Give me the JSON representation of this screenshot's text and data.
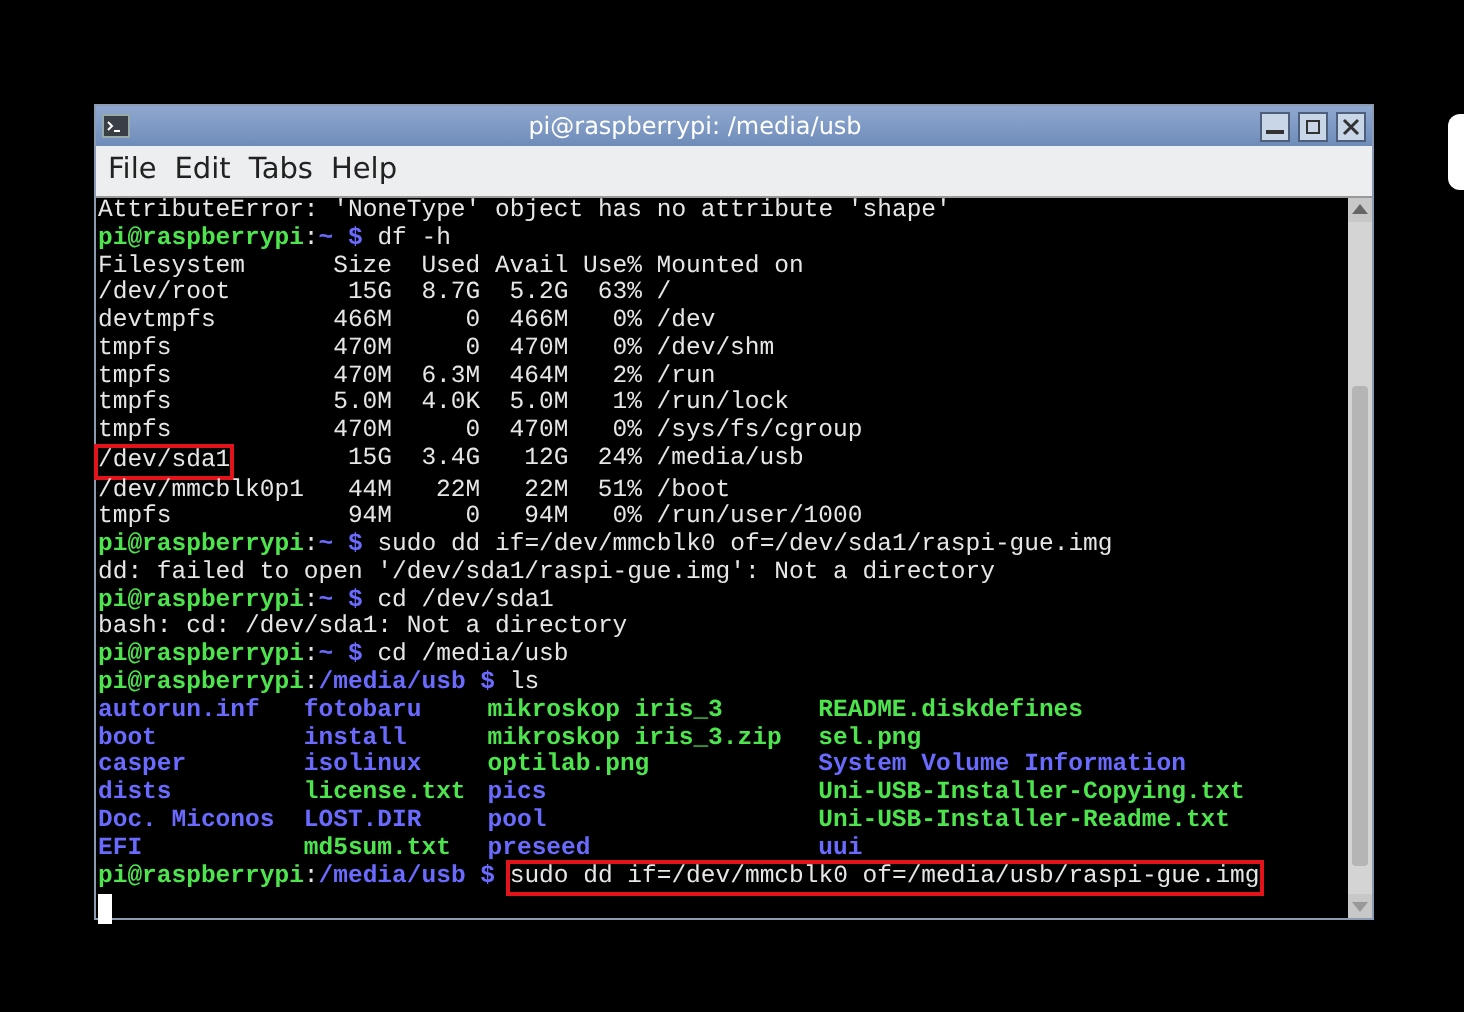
{
  "window": {
    "title": "pi@raspberrypi: /media/usb"
  },
  "menu": [
    {
      "label": "File"
    },
    {
      "label": "Edit"
    },
    {
      "label": "Tabs"
    },
    {
      "label": "Help"
    }
  ],
  "terminal": {
    "blocks": [
      {
        "kind": "line",
        "segments": [
          {
            "text": "AttributeError: 'NoneType' object has no attribute 'shape'",
            "kind": "plain"
          }
        ]
      },
      {
        "kind": "line",
        "segments": [
          {
            "text": "pi@raspberrypi",
            "kind": "user"
          },
          {
            "text": ":",
            "kind": "plain"
          },
          {
            "text": "~ $",
            "kind": "path"
          },
          {
            "text": "df -h",
            "kind": "plain"
          }
        ]
      },
      {
        "kind": "table",
        "columns": [
          "Filesystem",
          "Size",
          "Used",
          "Avail",
          "Use%",
          "Mounted on"
        ],
        "rows": [
          {
            "cells": [
              "/dev/root",
              "15G",
              "8.7G",
              "5.2G",
              "63%",
              "/"
            ],
            "highlighted": false
          },
          {
            "cells": [
              "devtmpfs",
              "466M",
              "0",
              "466M",
              "0%",
              "/dev"
            ],
            "highlighted": false
          },
          {
            "cells": [
              "tmpfs",
              "470M",
              "0",
              "470M",
              "0%",
              "/dev/shm"
            ],
            "highlighted": false
          },
          {
            "cells": [
              "tmpfs",
              "470M",
              "6.3M",
              "464M",
              "2%",
              "/run"
            ],
            "highlighted": false
          },
          {
            "cells": [
              "tmpfs",
              "5.0M",
              "4.0K",
              "5.0M",
              "1%",
              "/run/lock"
            ],
            "highlighted": false
          },
          {
            "cells": [
              "tmpfs",
              "470M",
              "0",
              "470M",
              "0%",
              "/sys/fs/cgroup"
            ],
            "highlighted": false
          },
          {
            "cells": [
              "/dev/sda1",
              "15G",
              "3.4G",
              "12G",
              "24%",
              "/media/usb"
            ],
            "highlighted": true
          },
          {
            "cells": [
              "/dev/mmcblk0p1",
              "44M",
              "22M",
              "22M",
              "51%",
              "/boot"
            ],
            "highlighted": false
          },
          {
            "cells": [
              "tmpfs",
              "94M",
              "0",
              "94M",
              "0%",
              "/run/user/1000"
            ],
            "highlighted": false
          }
        ]
      },
      {
        "kind": "line",
        "segments": [
          {
            "text": "pi@raspberrypi",
            "kind": "user"
          },
          {
            "text": ":",
            "kind": "plain"
          },
          {
            "text": "~ $",
            "kind": "path"
          },
          {
            "text": "sudo dd if=/dev/mmcblk0 of=/dev/sda1/raspi-gue.img",
            "kind": "plain"
          }
        ]
      },
      {
        "kind": "line",
        "segments": [
          {
            "text": "dd: failed to open '/dev/sda1/raspi-gue.img': Not a directory",
            "kind": "plain"
          }
        ]
      },
      {
        "kind": "line",
        "segments": [
          {
            "text": "pi@raspberrypi",
            "kind": "user"
          },
          {
            "text": ":",
            "kind": "plain"
          },
          {
            "text": "~ $",
            "kind": "path"
          },
          {
            "text": "cd /dev/sda1",
            "kind": "plain"
          }
        ]
      },
      {
        "kind": "line",
        "segments": [
          {
            "text": "bash: cd: /dev/sda1: Not a directory",
            "kind": "plain"
          }
        ]
      },
      {
        "kind": "line",
        "segments": [
          {
            "text": "pi@raspberrypi",
            "kind": "user"
          },
          {
            "text": ":",
            "kind": "plain"
          },
          {
            "text": "~ $",
            "kind": "path"
          },
          {
            "text": "cd /media/usb",
            "kind": "plain"
          }
        ]
      },
      {
        "kind": "line",
        "segments": [
          {
            "text": "pi@raspberrypi",
            "kind": "user"
          },
          {
            "text": ":",
            "kind": "plain"
          },
          {
            "text": "/media/usb $",
            "kind": "path"
          },
          {
            "text": "ls",
            "kind": "plain"
          }
        ]
      },
      {
        "kind": "listing",
        "rows": [
          [
            {
              "text": "autorun.inf",
              "kind": "dir"
            },
            {
              "text": "fotobaru",
              "kind": "dir"
            },
            {
              "text": "mikroskop iris_3",
              "kind": "file"
            },
            {
              "text": "README.diskdefines",
              "kind": "file"
            }
          ],
          [
            {
              "text": "boot",
              "kind": "dir"
            },
            {
              "text": "install",
              "kind": "dir"
            },
            {
              "text": "mikroskop iris_3.zip",
              "kind": "file"
            },
            {
              "text": "sel.png",
              "kind": "file"
            }
          ],
          [
            {
              "text": "casper",
              "kind": "dir"
            },
            {
              "text": "isolinux",
              "kind": "dir"
            },
            {
              "text": "optilab.png",
              "kind": "file"
            },
            {
              "text": "System Volume Information",
              "kind": "dir"
            }
          ],
          [
            {
              "text": "dists",
              "kind": "dir"
            },
            {
              "text": "license.txt",
              "kind": "file"
            },
            {
              "text": "pics",
              "kind": "dir"
            },
            {
              "text": "Uni-USB-Installer-Copying.txt",
              "kind": "file"
            }
          ],
          [
            {
              "text": "Doc. Miconos",
              "kind": "dir"
            },
            {
              "text": "LOST.DIR",
              "kind": "dir"
            },
            {
              "text": "pool",
              "kind": "dir"
            },
            {
              "text": "Uni-USB-Installer-Readme.txt",
              "kind": "file"
            }
          ],
          [
            {
              "text": "EFI",
              "kind": "dir"
            },
            {
              "text": "md5sum.txt",
              "kind": "file"
            },
            {
              "text": "preseed",
              "kind": "dir"
            },
            {
              "text": "uui",
              "kind": "dir"
            }
          ]
        ]
      },
      {
        "kind": "line",
        "segments": [
          {
            "text": "pi@raspberrypi",
            "kind": "user"
          },
          {
            "text": ":",
            "kind": "plain"
          },
          {
            "text": "/media/usb $",
            "kind": "path"
          },
          {
            "text": "sudo dd if=/dev/mmcblk0 of=/media/usb/raspi-gue.img",
            "kind": "plain",
            "highlighted": true
          }
        ]
      },
      {
        "kind": "cursor"
      }
    ]
  }
}
